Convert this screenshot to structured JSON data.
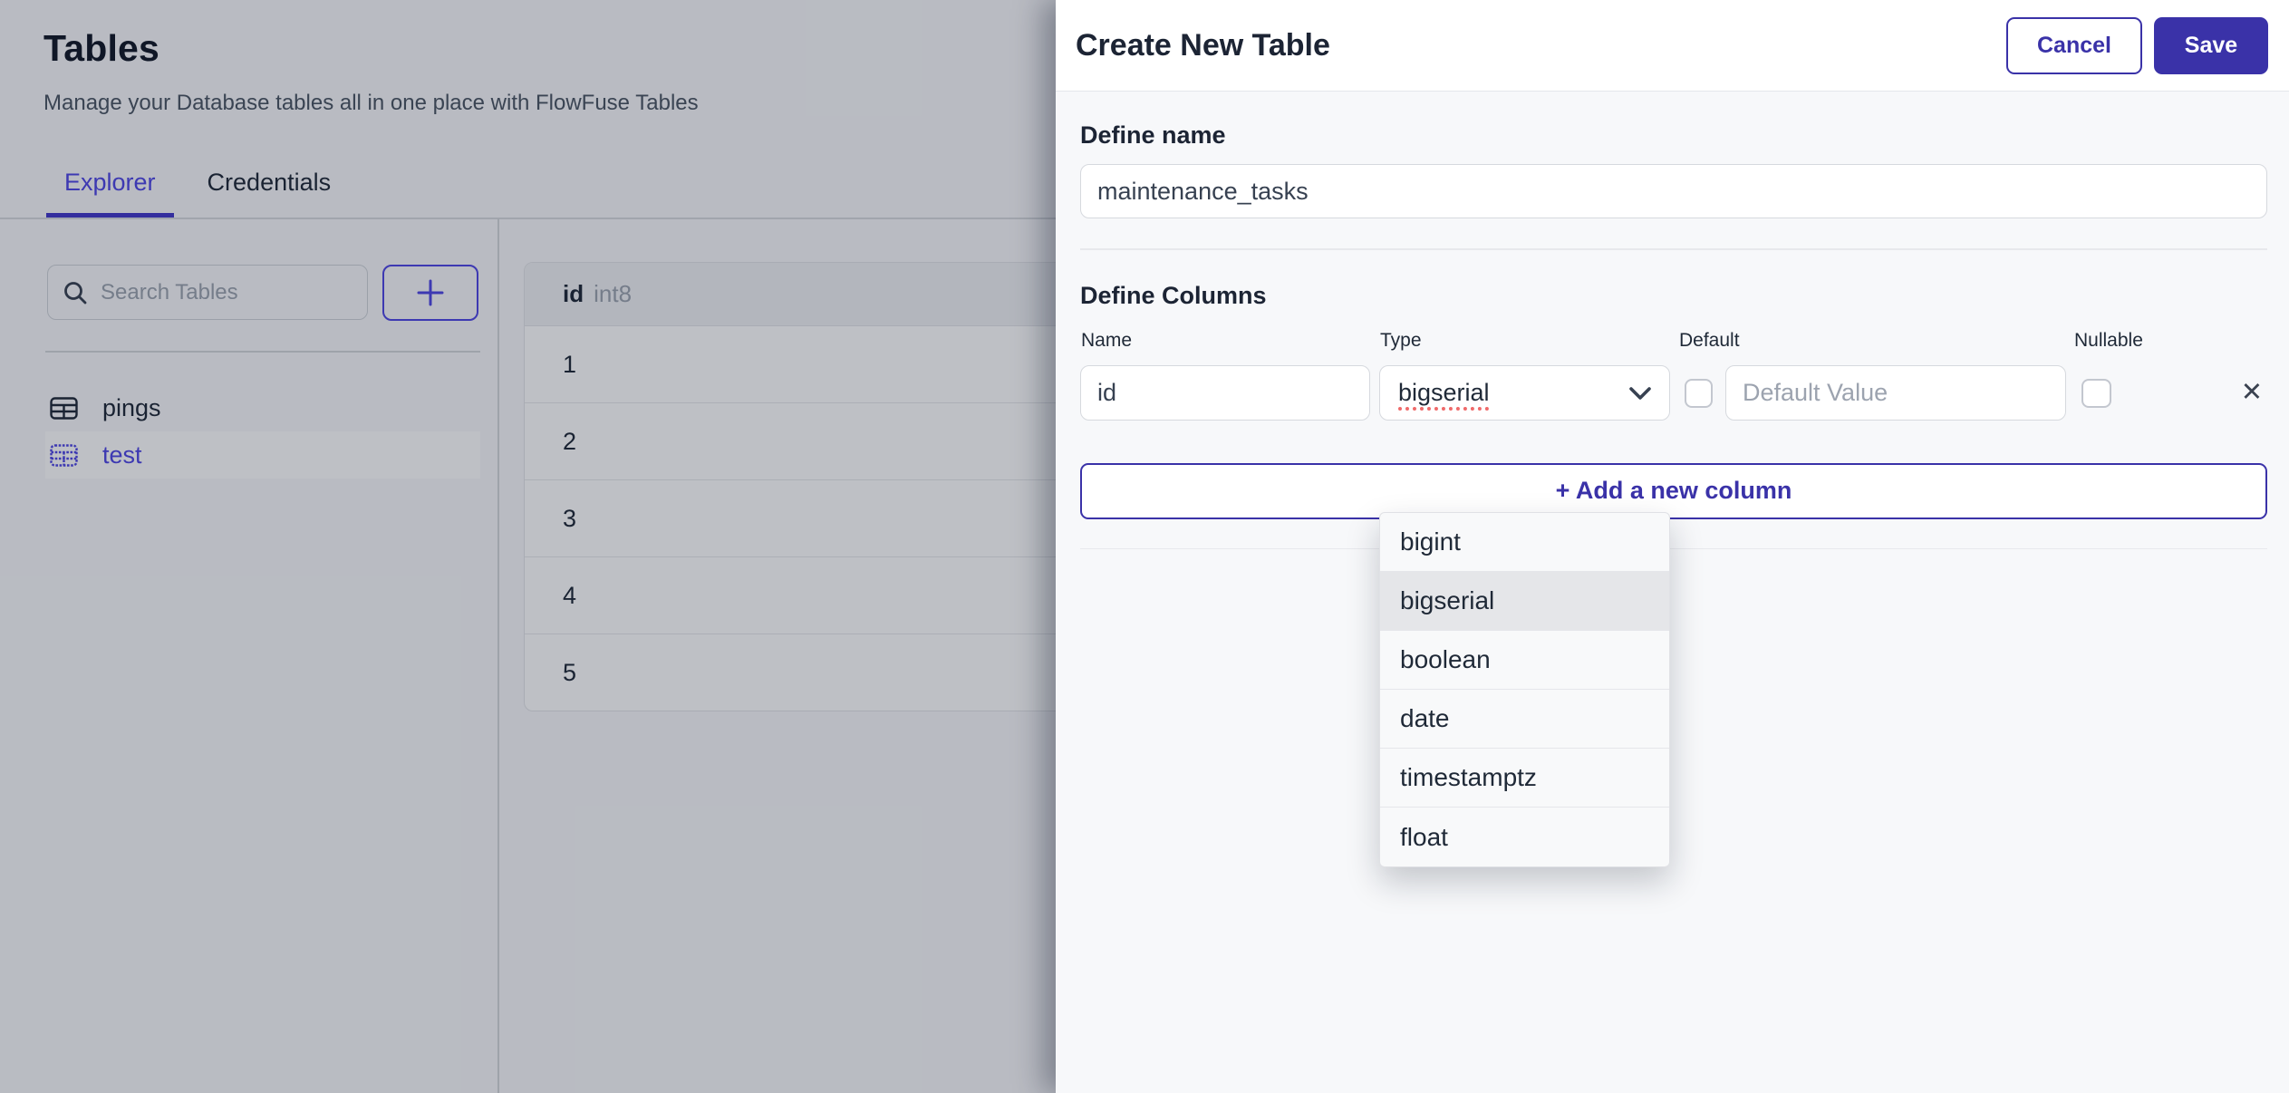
{
  "colors": {
    "accent_panel": "#3a32a8",
    "accent_left": "#4f46e5",
    "tab_underline": "#4338ca",
    "panel_body_bg": "#f7f8fa",
    "dim_overlay": "rgba(15,23,42,0.27)",
    "placeholder_gray": "#9ca3af"
  },
  "page": {
    "title": "Tables",
    "subtitle": "Manage your Database tables all in one place with FlowFuse Tables",
    "tabs": [
      {
        "label": "Explorer"
      },
      {
        "label": "Credentials"
      }
    ],
    "search": {
      "placeholder": "Search Tables"
    },
    "add_table_icon": "+",
    "tables": [
      {
        "label": "pings",
        "selected": false
      },
      {
        "label": "test",
        "selected": true
      }
    ],
    "grid": {
      "column_header": {
        "name": "id",
        "type": "int8"
      },
      "rows": [
        "1",
        "2",
        "3",
        "4",
        "5"
      ]
    }
  },
  "panel": {
    "title": "Create New Table",
    "cancel_label": "Cancel",
    "save_label": "Save",
    "define_name": {
      "heading": "Define name",
      "value": "maintenance_tasks"
    },
    "define_columns": {
      "heading": "Define Columns",
      "labels": {
        "name": "Name",
        "type": "Type",
        "default": "Default",
        "nullable": "Nullable"
      },
      "row": {
        "name_value": "id",
        "type_value": "bigserial",
        "default_placeholder": "Default Value",
        "delete_icon": "✕"
      },
      "add_button_label": "+ Add a new column"
    },
    "type_dropdown": {
      "selected": "bigserial",
      "options": [
        "bigint",
        "bigserial",
        "boolean",
        "date",
        "timestamptz",
        "float"
      ]
    }
  }
}
